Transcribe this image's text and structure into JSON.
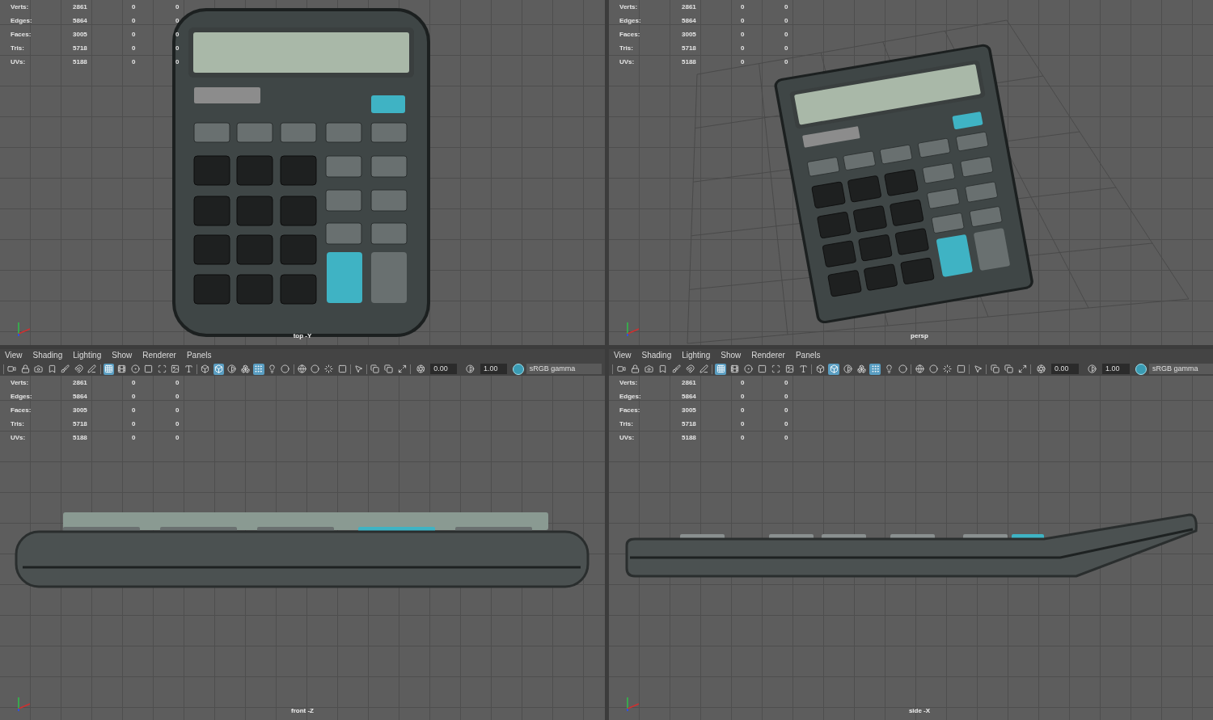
{
  "viewports": [
    {
      "kind": "top",
      "camera_label": "top -Y",
      "stats": [
        {
          "label": "Verts:",
          "values": [
            "2861",
            "0",
            "0"
          ]
        },
        {
          "label": "Edges:",
          "values": [
            "5864",
            "0",
            "0"
          ]
        },
        {
          "label": "Faces:",
          "values": [
            "3005",
            "0",
            "0"
          ]
        },
        {
          "label": "Tris:",
          "values": [
            "5718",
            "0",
            "0"
          ]
        },
        {
          "label": "UVs:",
          "values": [
            "5188",
            "0",
            "0"
          ]
        }
      ]
    },
    {
      "kind": "persp",
      "camera_label": "persp",
      "stats": [
        {
          "label": "Verts:",
          "values": [
            "2861",
            "0",
            "0"
          ]
        },
        {
          "label": "Edges:",
          "values": [
            "5864",
            "0",
            "0"
          ]
        },
        {
          "label": "Faces:",
          "values": [
            "3005",
            "0",
            "0"
          ]
        },
        {
          "label": "Tris:",
          "values": [
            "5718",
            "0",
            "0"
          ]
        },
        {
          "label": "UVs:",
          "values": [
            "5188",
            "0",
            "0"
          ]
        }
      ]
    },
    {
      "kind": "front",
      "camera_label": "front -Z",
      "menu": [
        "View",
        "Shading",
        "Lighting",
        "Show",
        "Renderer",
        "Panels"
      ],
      "toolbar": {
        "groups": [
          [
            false,
            false,
            false,
            false,
            false,
            false,
            false
          ],
          [
            true,
            false,
            false,
            false,
            false,
            false,
            false
          ],
          [
            false,
            true,
            false,
            false,
            true,
            false,
            false
          ],
          [
            false,
            false,
            false,
            false
          ],
          [
            false
          ],
          [
            false,
            false,
            false
          ]
        ],
        "exposure": "0.00",
        "gamma": "1.00",
        "color_management": {
          "on": true,
          "label": "sRGB gamma"
        }
      },
      "stats": [
        {
          "label": "Verts:",
          "values": [
            "2861",
            "0",
            "0"
          ]
        },
        {
          "label": "Edges:",
          "values": [
            "5864",
            "0",
            "0"
          ]
        },
        {
          "label": "Faces:",
          "values": [
            "3005",
            "0",
            "0"
          ]
        },
        {
          "label": "Tris:",
          "values": [
            "5718",
            "0",
            "0"
          ]
        },
        {
          "label": "UVs:",
          "values": [
            "5188",
            "0",
            "0"
          ]
        }
      ]
    },
    {
      "kind": "side",
      "camera_label": "side -X",
      "menu": [
        "View",
        "Shading",
        "Lighting",
        "Show",
        "Renderer",
        "Panels"
      ],
      "toolbar": {
        "groups": [
          [
            false,
            false,
            false,
            false,
            false,
            false,
            false
          ],
          [
            true,
            false,
            false,
            false,
            false,
            false,
            false
          ],
          [
            false,
            true,
            false,
            false,
            true,
            false,
            false
          ],
          [
            false,
            false,
            false,
            false
          ],
          [
            false
          ],
          [
            false,
            false,
            false
          ]
        ],
        "exposure": "0.00",
        "gamma": "1.00",
        "color_management": {
          "on": true,
          "label": "sRGB gamma"
        }
      },
      "stats": [
        {
          "label": "Verts:",
          "values": [
            "2861",
            "0",
            "0"
          ]
        },
        {
          "label": "Edges:",
          "values": [
            "5864",
            "0",
            "0"
          ]
        },
        {
          "label": "Faces:",
          "values": [
            "3005",
            "0",
            "0"
          ]
        },
        {
          "label": "Tris:",
          "values": [
            "5718",
            "0",
            "0"
          ]
        },
        {
          "label": "UVs:",
          "values": [
            "5188",
            "0",
            "0"
          ]
        }
      ]
    }
  ]
}
